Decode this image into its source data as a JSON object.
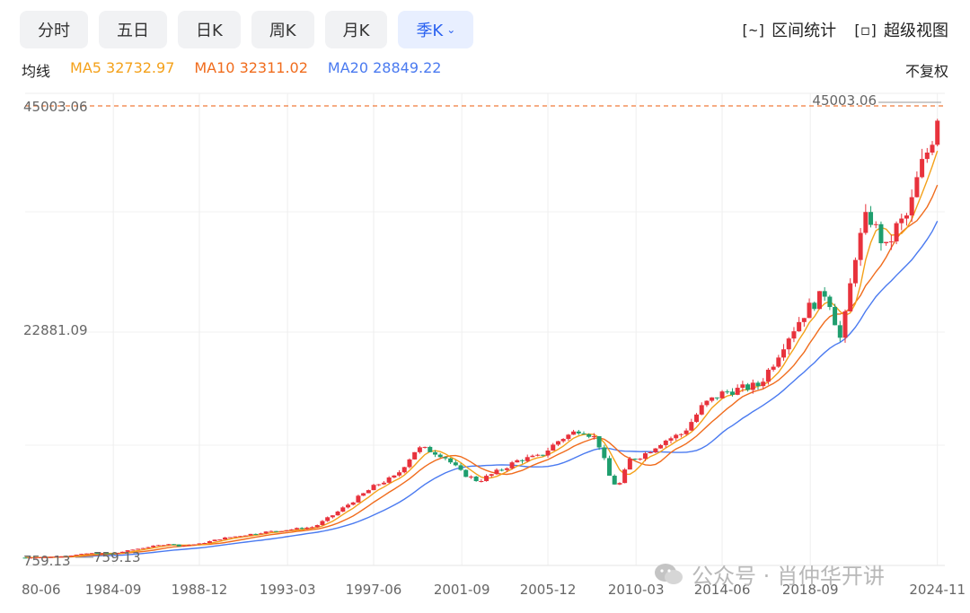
{
  "tabs": [
    {
      "label": "分时",
      "active": false
    },
    {
      "label": "五日",
      "active": false
    },
    {
      "label": "日K",
      "active": false
    },
    {
      "label": "周K",
      "active": false
    },
    {
      "label": "月K",
      "active": false
    },
    {
      "label": "季K",
      "active": true
    }
  ],
  "tools": {
    "range_stats": "区间统计",
    "super_view": "超级视图"
  },
  "ma_legend": {
    "label": "均线",
    "ma5": "MA5 32732.97",
    "ma10": "MA10 32311.02",
    "ma20": "MA20 28849.22"
  },
  "adjust_label": "不复权",
  "watermark": "公众号 · 肖仲华开讲",
  "colors": {
    "up": "#e8323c",
    "down": "#1f9e6e",
    "ma5": "#f4a11a",
    "ma10": "#f06c1d",
    "ma20": "#4a7af0",
    "active_tab": "#2b62f0"
  },
  "chart_data": {
    "type": "candlestick",
    "ylim": [
      759.13,
      45003.06
    ],
    "y_ticks": [
      "759.13",
      "22881.09",
      "45003.06"
    ],
    "max_label": "45003.06",
    "min_label": "759.13",
    "x_ticks": [
      "80-06",
      "1984-09",
      "1988-12",
      "1993-03",
      "1997-06",
      "2001-09",
      "2005-12",
      "2010-03",
      "2014-06",
      "2018-09",
      "2024-11"
    ],
    "close_series": [
      [
        1980.4,
        820
      ],
      [
        1981.5,
        880
      ],
      [
        1982.5,
        1000
      ],
      [
        1983.5,
        1250
      ],
      [
        1984.7,
        1200
      ],
      [
        1985.5,
        1550
      ],
      [
        1986.5,
        1900
      ],
      [
        1987.5,
        2200
      ],
      [
        1987.8,
        1950
      ],
      [
        1988.9,
        2170
      ],
      [
        1990.0,
        2700
      ],
      [
        1991.0,
        3000
      ],
      [
        1992.0,
        3300
      ],
      [
        1993.2,
        3550
      ],
      [
        1994.5,
        3830
      ],
      [
        1995.5,
        5100
      ],
      [
        1996.5,
        6500
      ],
      [
        1997.5,
        7900
      ],
      [
        1998.5,
        8800
      ],
      [
        1999.5,
        11500
      ],
      [
        2000.0,
        11400
      ],
      [
        2000.8,
        10800
      ],
      [
        2001.7,
        9100
      ],
      [
        2002.5,
        8300
      ],
      [
        2003.5,
        9300
      ],
      [
        2004.5,
        10400
      ],
      [
        2005.5,
        10700
      ],
      [
        2006.5,
        12400
      ],
      [
        2007.5,
        13400
      ],
      [
        2008.3,
        12400
      ],
      [
        2008.9,
        8800
      ],
      [
        2009.3,
        7600
      ],
      [
        2009.9,
        10400
      ],
      [
        2010.5,
        10800
      ],
      [
        2011.5,
        12200
      ],
      [
        2012.5,
        13000
      ],
      [
        2013.5,
        15800
      ],
      [
        2014.5,
        17000
      ],
      [
        2015.5,
        17400
      ],
      [
        2016.2,
        17700
      ],
      [
        2016.9,
        19900
      ],
      [
        2017.5,
        22100
      ],
      [
        2018.5,
        25000
      ],
      [
        2019.5,
        26900
      ],
      [
        2020.2,
        21900
      ],
      [
        2020.9,
        30500
      ],
      [
        2021.5,
        34500
      ],
      [
        2022.4,
        31000
      ],
      [
        2022.9,
        33100
      ],
      [
        2023.5,
        34400
      ],
      [
        2024.0,
        38500
      ],
      [
        2024.6,
        41500
      ],
      [
        2025.0,
        45003
      ]
    ],
    "ma5_last": 32732.97,
    "ma10_last": 32311.02,
    "ma20_last": 28849.22
  }
}
